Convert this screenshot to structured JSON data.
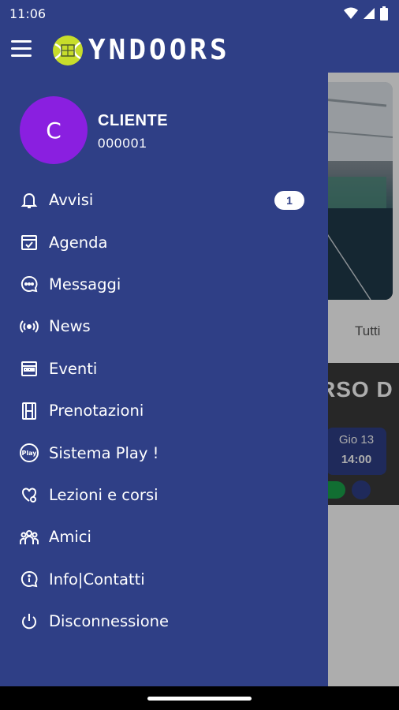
{
  "status_bar": {
    "time": "11:06"
  },
  "app_bar": {
    "logo_text": "YNDOORS"
  },
  "background": {
    "tab_label": "Tutti",
    "card_title": "RSO D",
    "card_day": "Gio 13",
    "card_time": "14:00"
  },
  "drawer": {
    "avatar_initial": "C",
    "user_name": "CLIENTE",
    "user_code": "000001",
    "menu": [
      {
        "label": "Avvisi",
        "icon": "bell-icon",
        "badge": "1"
      },
      {
        "label": "Agenda",
        "icon": "calendar-check-icon"
      },
      {
        "label": "Messaggi",
        "icon": "chat-bubble-icon"
      },
      {
        "label": "News",
        "icon": "broadcast-icon"
      },
      {
        "label": "Eventi",
        "icon": "calendar-grid-icon"
      },
      {
        "label": "Prenotazioni",
        "icon": "film-strip-icon"
      },
      {
        "label": "Sistema Play !",
        "icon": "play-badge-icon"
      },
      {
        "label": "Lezioni e corsi",
        "icon": "heart-check-icon"
      },
      {
        "label": "Amici",
        "icon": "group-icon"
      },
      {
        "label": "Info|Contatti",
        "icon": "info-bubble-icon"
      },
      {
        "label": "Disconnessione",
        "icon": "power-icon"
      }
    ]
  },
  "colors": {
    "primary": "#2f3f86",
    "avatar": "#8a1fe0",
    "logo_ball": "#c7dd2b"
  }
}
